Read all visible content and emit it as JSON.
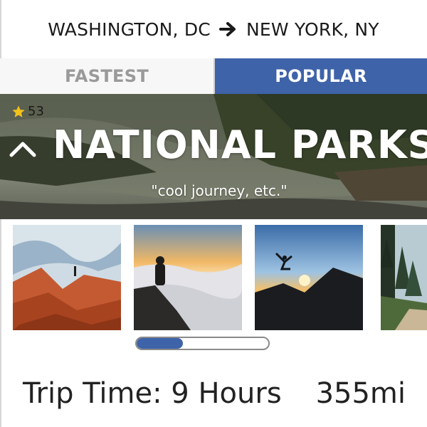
{
  "route": {
    "origin": "WASHINGTON, DC",
    "destination": "NEW YORK, NY",
    "arrow_icon": "arrow-right-icon"
  },
  "tabs": [
    {
      "label": "FASTEST",
      "active": false
    },
    {
      "label": "POPULAR",
      "active": true
    }
  ],
  "hero": {
    "rating_icon": "star-icon",
    "rating": "53",
    "collapse_icon": "chevron-up-icon",
    "title": "NATIONAL PARKS",
    "quote": "\"cool journey, etc.\""
  },
  "gallery": {
    "photos": [
      {
        "name": "red-rock-canyon-photo"
      },
      {
        "name": "cloud-sea-hiker-photo"
      },
      {
        "name": "sunset-jump-photo"
      },
      {
        "name": "forest-trail-photo"
      }
    ],
    "scroll_progress": 0.35
  },
  "footer": {
    "trip_time": "Trip Time: 9 Hours",
    "distance": "355mi"
  },
  "colors": {
    "accent": "#3e63a8",
    "star": "#f2c21b",
    "inactive_tab_text": "#9a9a9a"
  }
}
